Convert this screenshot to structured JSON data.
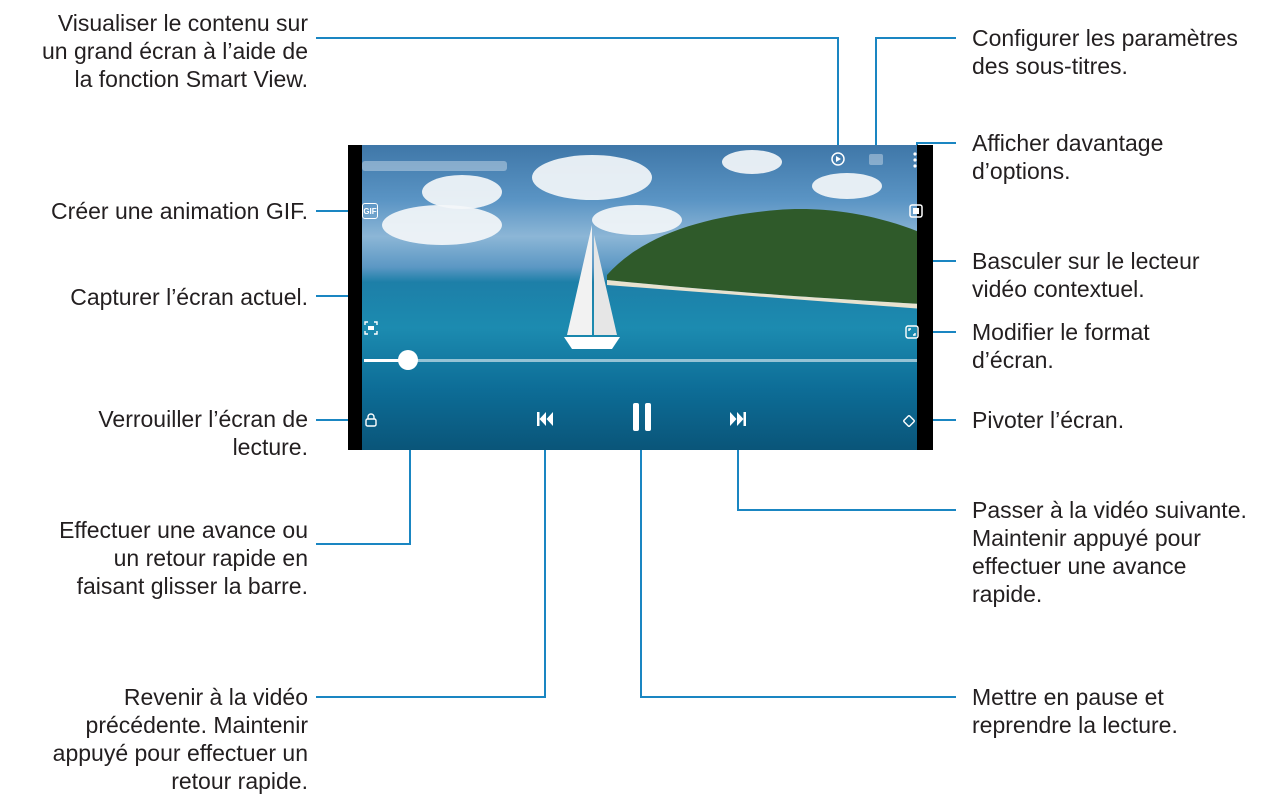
{
  "annotations": {
    "smart_view": "Visualiser le contenu sur\nun grand écran à l’aide de\nla fonction Smart View.",
    "gif": "Créer une animation GIF.",
    "capture": "Capturer l’écran actuel.",
    "lock": "Verrouiller l’écran de\nlecture.",
    "seek": "Effectuer une avance ou\nun retour rapide en\nfaisant glisser la barre.",
    "previous": "Revenir à la vidéo\nprécédente. Maintenir\nappuyé pour effectuer un\nretour rapide.",
    "subtitles": "Configurer les paramètres\ndes sous-titres.",
    "more_options": "Afficher davantage\nd’options.",
    "popup": "Basculer sur le lecteur\nvidéo contextuel.",
    "ratio": "Modifier le format\nd’écran.",
    "rotate": "Pivoter l’écran.",
    "next": "Passer à la vidéo suivante.\nMaintenir appuyé pour\neffectuer une avance\nrapide.",
    "pause": "Mettre en pause et\nreprendre la lecture."
  },
  "player": {
    "gif_label": "GIF",
    "progress": 0.08,
    "icons": [
      "smart-view-icon",
      "subtitles-icon",
      "more-options-icon",
      "gif-icon",
      "popup-player-icon",
      "capture-icon",
      "aspect-ratio-icon",
      "lock-icon",
      "rotate-icon",
      "previous-icon",
      "pause-icon",
      "next-icon"
    ]
  },
  "colors": {
    "leader": "#1a86c2",
    "text": "#231f20"
  }
}
